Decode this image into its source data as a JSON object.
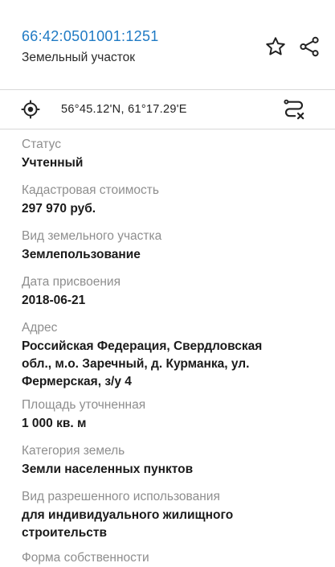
{
  "header": {
    "cadastral_number": "66:42:0501001:1251",
    "object_type": "Земельный участок"
  },
  "icons": {
    "favorite": "star-icon",
    "share": "share-icon",
    "locate": "target-icon",
    "route": "route-cancel-icon"
  },
  "coordinates": {
    "text": "56°45.12'N, 61°17.29'E"
  },
  "fields": [
    {
      "label": "Статус",
      "value": "Учтенный"
    },
    {
      "label": "Кадастровая стоимость",
      "value": "297 970 руб."
    },
    {
      "label": "Вид земельного участка",
      "value": "Землепользование"
    },
    {
      "label": "Дата присвоения",
      "value": "2018-06-21"
    },
    {
      "label": "Адрес",
      "value": "Российская Федерация, Свердловская\nобл., м.о. Заречный, д. Курманка, ул.\nФермерская, з/у 4"
    },
    {
      "label": "Площадь уточненная",
      "value": "1 000 кв. м"
    },
    {
      "label": "Категория земель",
      "value": "Земли населенных пунктов"
    },
    {
      "label": "Вид разрешенного использования",
      "value": "для индивидуального жилищного\nстроительств"
    },
    {
      "label": "Форма собственности",
      "value": ""
    }
  ],
  "colors": {
    "link": "#1f7ac4",
    "label": "#8e8e8e",
    "divider": "#d8d8d8"
  }
}
